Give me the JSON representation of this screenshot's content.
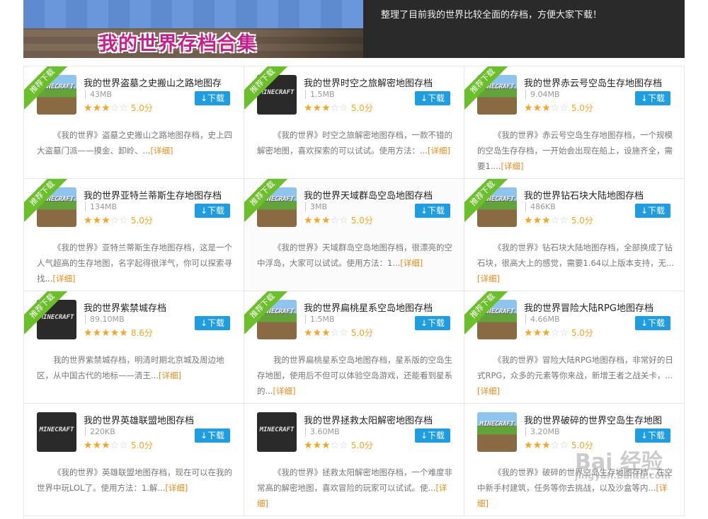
{
  "banner": {
    "title": "我的世界存档合集",
    "text": "整理了目前我的世界比较全面的存档，方便大家下载！"
  },
  "ribbon_label": "推荐下载",
  "download_label": "下载",
  "more_label": "[详细]",
  "watermark": {
    "main": "Bai 经验",
    "sub": "jingyan.baidu.com"
  },
  "cards": [
    {
      "title": "我的世界盗墓之史搬山之路地图存",
      "size": "43MB",
      "rating": 2.5,
      "score": "5.0分",
      "desc": "《我的世界》盗墓之史搬山之路地图存档，史上四大盗墓门派——摸金、卸岭、...",
      "thumb": "grass",
      "thumb_text": "MINECRAFT",
      "featured": true
    },
    {
      "title": "我的世界时空之旅解密地图存档",
      "size": "1.5MB",
      "rating": 2.5,
      "score": "5.0分",
      "desc": "《我的世界》时空之旅解密地图存档，一款不错的解密地图，喜欢探索的可以试试。使用方法：...",
      "thumb": "dark",
      "thumb_text": "MINECRAFT",
      "featured": true
    },
    {
      "title": "我的世界赤云号空岛生存地图存档",
      "size": "9.04MB",
      "rating": 2.5,
      "score": "5.0分",
      "desc": "《我的世界》赤云号空岛生存地图存档，一个规模的空岛生存存档，一开始会出现在船上，设施齐全，需要1....",
      "thumb": "grass",
      "thumb_text": "MINECRAFT",
      "featured": true
    },
    {
      "title": "我的世界亚特兰蒂斯生存地图存档",
      "size": "134MB",
      "rating": 2.5,
      "score": "5.0分",
      "desc": "《我的世界》亚特兰蒂斯生存地图存档，这是一个人气超高的生存地图，名字起得很洋气，你可以探索寻找...",
      "thumb": "grass",
      "thumb_text": "MINECRAFT",
      "featured": true
    },
    {
      "title": "我的世界天域群岛空岛地图存档",
      "size": "3MB",
      "rating": 2.5,
      "score": "5.0分",
      "desc": "《我的世界》天域群岛空岛地图存档，很漂亮的空中浮岛，大家可以试试。使用方法：1...",
      "thumb": "grass",
      "thumb_text": "MINECRAFT",
      "featured": true,
      "highlight": true
    },
    {
      "title": "我的世界钻石块大陆地图存档",
      "size": "486KB",
      "rating": 2.5,
      "score": "5.0分",
      "desc": "《我的世界》钻石块大陆地图存档，全部换成了钻石块，很高大上的感觉，需要1.64以上版本支持，无...",
      "thumb": "grass",
      "thumb_text": "MINECRAFT",
      "featured": true
    },
    {
      "title": "我的世界紫禁城存档",
      "size": "89.10MB",
      "rating": 4.5,
      "score": "8.6分",
      "desc": "我的世界紫禁城存档，明清时期北京城及周边地区，从中国古代的地标——清王...",
      "thumb": "dark",
      "thumb_text": "MINECRAFT",
      "featured": true
    },
    {
      "title": "我的世界扁桃星系空岛地图存档",
      "size": "1.5MB",
      "rating": 2.5,
      "score": "5.0分",
      "desc": "我的世界扁桃星系空岛地图存档，星系版的空岛生存地图，使用后不但可以体验空岛游戏，还能看到星系的...",
      "thumb": "grass",
      "thumb_text": "MINECRAFT",
      "featured": true
    },
    {
      "title": "我的世界冒险大陆RPG地图存档",
      "size": "4.66MB",
      "rating": 2.5,
      "score": "5.0分",
      "desc": "《我的世界》冒险大陆RPG地图存档，非常好的日式RPG，众多的元素等你来战，新增王者之战关卡，...",
      "thumb": "grass",
      "thumb_text": "MINECRAFT",
      "featured": true
    },
    {
      "title": "我的世界英雄联盟地图存档",
      "size": "220KB",
      "rating": 2.5,
      "score": "5.0分",
      "desc": "《我的世界》英雄联盟地图存档，现在可以在我的世界中玩LOL了。使用方法：1.解...",
      "thumb": "dark",
      "thumb_text": "MINECRAFT",
      "featured": false
    },
    {
      "title": "我的世界拯救太阳解密地图存档",
      "size": "3.60MB",
      "rating": 2.5,
      "score": "5.0分",
      "desc": "《我的世界》拯救太阳解密地图存档，一个难度非常高的解密地图，喜欢冒险的玩家可以试试。使...",
      "thumb": "dark",
      "thumb_text": "MINECRAFT",
      "featured": false
    },
    {
      "title": "我的世界破碎的世界空岛生存地图",
      "size": "3.20MB",
      "rating": 2.5,
      "score": "5.0分",
      "desc": "《我的世界》破碎的世界空岛生存地图存档，在空中新手村建筑，任务等你去挑战，以及沙盒等内...",
      "thumb": "grass",
      "thumb_text": "MINECRAFT",
      "featured": false
    }
  ]
}
